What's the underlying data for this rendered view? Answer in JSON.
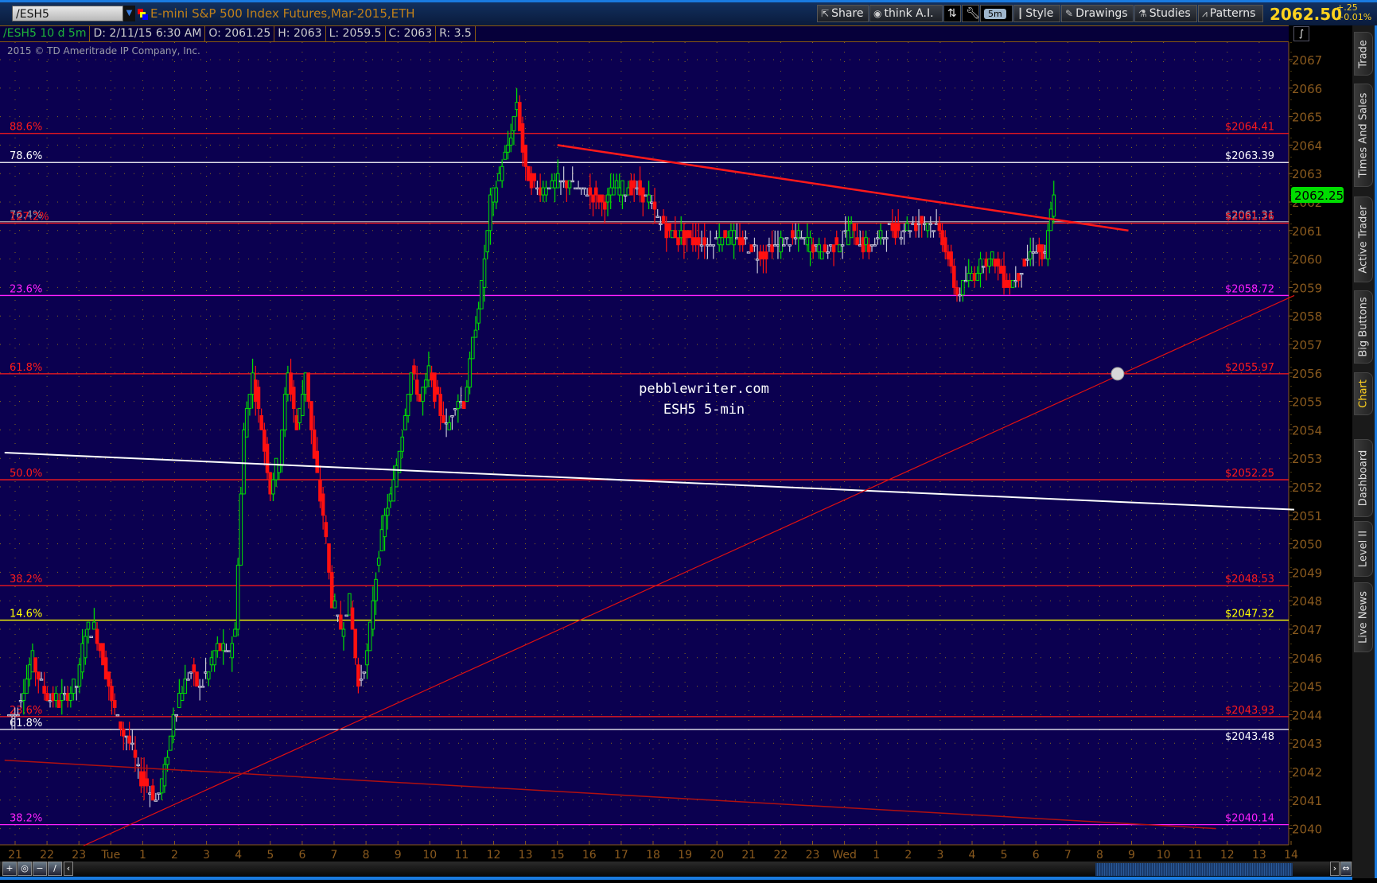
{
  "topbar": {
    "symbol": "/ESH5",
    "title": "E-mini S&P 500 Index Futures,Mar-2015,ETH",
    "buttons": {
      "share": "Share",
      "think_ai": "think A.I.",
      "timeframe": "5m",
      "style": "Style",
      "drawings": "Drawings",
      "studies": "Studies",
      "patterns": "Patterns"
    },
    "last_price": "2062.50",
    "change": "+.25",
    "change_pct": "+0.01%"
  },
  "header": {
    "chart_symbol": "/ESH5 10 d 5m",
    "date": "D: 2/11/15 6:30 AM",
    "open": "O: 2061.25",
    "high": "H: 2063",
    "low": "L: 2059.5",
    "close": "C: 2063",
    "range": "R: 3.5"
  },
  "copyright": "2015 © TD Ameritrade IP Company, Inc.",
  "watermark": {
    "line1": "pebblewriter.com",
    "line2": "ESH5 5-min"
  },
  "sidebar": {
    "tabs": [
      "Trade",
      "Times And Sales",
      "Active Trader",
      "Big Buttons",
      "Chart",
      "Dashboard",
      "Level II",
      "Live News"
    ],
    "active": "Chart"
  },
  "colors": {
    "background": "#0b0050",
    "up": "#00e000",
    "down": "#ff1010",
    "axis": "#8a5a1e",
    "grid": "#8a6a1a"
  },
  "chart_data": {
    "type": "candlestick",
    "price_range": [
      2039.4,
      2067.6
    ],
    "y_ticks": [
      2040,
      2041,
      2042,
      2043,
      2044,
      2045,
      2046,
      2047,
      2048,
      2049,
      2050,
      2051,
      2052,
      2053,
      2054,
      2055,
      2056,
      2057,
      2058,
      2059,
      2060,
      2061,
      2062,
      2063,
      2064,
      2065,
      2066,
      2067
    ],
    "x_tick_labels": [
      "21",
      "22",
      "23",
      "Tue",
      "1",
      "2",
      "3",
      "4",
      "5",
      "6",
      "7",
      "8",
      "9",
      "10",
      "11",
      "12",
      "13",
      "15",
      "16",
      "17",
      "18",
      "19",
      "20",
      "21",
      "22",
      "23",
      "Wed",
      "1",
      "2",
      "3",
      "4",
      "5",
      "6",
      "7",
      "8",
      "9",
      "10",
      "11",
      "12",
      "13",
      "14"
    ],
    "x_start_hour": -0.19,
    "x_step_hour": 0.276,
    "closes": [
      2044,
      2045,
      2046,
      2045,
      2044.5,
      2044.5,
      2044.7,
      2045,
      2047,
      2047,
      2046,
      2044.5,
      2043.5,
      2043,
      2042,
      2041.5,
      2041,
      2042,
      2044,
      2045,
      2045.5,
      2045,
      2045.5,
      2046.5,
      2046,
      2047,
      2054,
      2056,
      2054,
      2052,
      2053,
      2056,
      2054,
      2056,
      2053,
      2051,
      2048,
      2047,
      2048,
      2045,
      2046,
      2049,
      2051,
      2052,
      2054,
      2056,
      2055,
      2056,
      2055,
      2054,
      2055,
      2055,
      2057,
      2059,
      2062,
      2063,
      2064,
      2065.5,
      2063,
      2062.5,
      2062.5,
      2062.6,
      2062.7,
      2062.7,
      2062.4,
      2062.3,
      2062.2,
      2062,
      2062.4,
      2062.5,
      2062.5,
      2062.4,
      2062,
      2061.5,
      2061,
      2060.8,
      2060.7,
      2060.7,
      2060.6,
      2060.6,
      2060.8,
      2060.8,
      2060.6,
      2060.5,
      2060.3,
      2060.2,
      2060.4,
      2060.5,
      2060.7,
      2060.8,
      2060.6,
      2060.4,
      2060.3,
      2060.5,
      2060.7,
      2061,
      2060.6,
      2060.4,
      2060.7,
      2061,
      2061.1,
      2061,
      2061.2,
      2061.3,
      2061.2,
      2061,
      2060,
      2058.8,
      2059.2,
      2059.5,
      2060,
      2060,
      2059.5,
      2059,
      2059.5,
      2060,
      2060.5,
      2060,
      2062.5
    ],
    "current_price": {
      "value": 2062.25,
      "label": "2062.25"
    },
    "levels": [
      {
        "price": 2064.41,
        "color": "#ff1a1a",
        "left": "88.6%",
        "right": "$2064.41"
      },
      {
        "price": 2063.39,
        "color": "#ffffff",
        "left": "78.6%",
        "right": "$2063.39"
      },
      {
        "price": 2061.31,
        "color": "#9a9aa8",
        "left": "76.4%",
        "right": "$2061.31"
      },
      {
        "price": 2061.26,
        "color": "#ff1a1a",
        "left": "127.2%",
        "right": "$2061.26"
      },
      {
        "price": 2058.72,
        "color": "#ff20ff",
        "left": "23.6%",
        "right": "$2058.72"
      },
      {
        "price": 2055.97,
        "color": "#ff1a1a",
        "left": "61.8%",
        "right": "$2055.97"
      },
      {
        "price": 2052.25,
        "color": "#ff1a1a",
        "left": "50.0%",
        "right": "$2052.25"
      },
      {
        "price": 2048.53,
        "color": "#ff1a1a",
        "left": "38.2%",
        "right": "$2048.53"
      },
      {
        "price": 2047.32,
        "color": "#ffff00",
        "left": "14.6%",
        "right": "$2047.32"
      },
      {
        "price": 2043.93,
        "color": "#ff1a1a",
        "left": "23.6%",
        "right": "$2043.93"
      },
      {
        "price": 2043.48,
        "color": "#ffffff",
        "left": "61.8%",
        "right": "$2043.48"
      },
      {
        "price": 2040.14,
        "color": "#ff20ff",
        "left": "38.2%",
        "right": "$2040.14"
      }
    ],
    "trendlines": [
      {
        "name": "red-downtrend",
        "color": "#ff1a1a",
        "width": 2.5,
        "from": [
          17.0,
          2064.0
        ],
        "to": [
          34.9,
          2061.0
        ]
      },
      {
        "name": "white-trendline",
        "color": "#ffffff",
        "width": 2,
        "from": [
          -0.33,
          2053.2
        ],
        "to": [
          40.1,
          2051.2
        ]
      },
      {
        "name": "red-uptrend",
        "color": "#e01010",
        "width": 1.2,
        "from": [
          2.15,
          2039.4
        ],
        "to": [
          40.1,
          2058.72
        ]
      },
      {
        "name": "darkred-trendline",
        "color": "#b01010",
        "width": 1.5,
        "from": [
          -0.33,
          2042.4
        ],
        "to": [
          37.65,
          2040.0
        ]
      }
    ],
    "marker": {
      "hour": 34.56,
      "price": 2055.97
    }
  }
}
